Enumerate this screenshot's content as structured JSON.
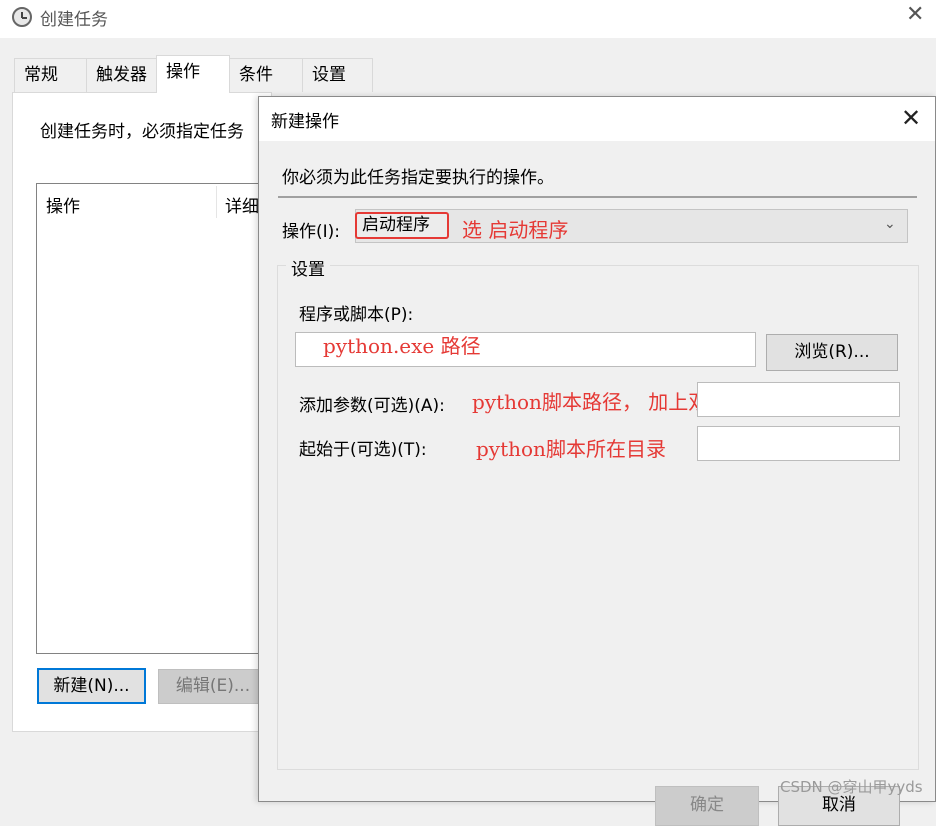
{
  "outer_window": {
    "title": "创建任务",
    "close_glyph": "✕",
    "tabs": [
      "常规",
      "触发器",
      "操作",
      "条件",
      "设置"
    ],
    "active_tab": "操作",
    "hint_text": "创建任务时，必须指定任务",
    "list_columns": [
      "操作",
      "详细"
    ],
    "new_button": "新建(N)...",
    "edit_button": "编辑(E)..."
  },
  "dialog": {
    "title": "新建操作",
    "close_glyph": "✕",
    "instruction": "你必须为此任务指定要执行的操作。",
    "action_label": "操作(I):",
    "action_value": "启动程序",
    "chevron": "⌄",
    "settings_legend": "设置",
    "program_label": "程序或脚本(P):",
    "program_value": "",
    "browse_button": "浏览(R)...",
    "args_label": "添加参数(可选)(A):",
    "args_value": "",
    "start_label": "起始于(可选)(T):",
    "start_value": "",
    "ok_button": "确定",
    "cancel_button": "取消"
  },
  "annotations": {
    "select_note": "选  启动程序",
    "program_note": "python.exe 路径",
    "args_note": "python脚本路径，  加上双引号“”",
    "start_note": "python脚本所在目录",
    "color": "#e53935"
  },
  "watermark": "CSDN @穿山甲yyds"
}
